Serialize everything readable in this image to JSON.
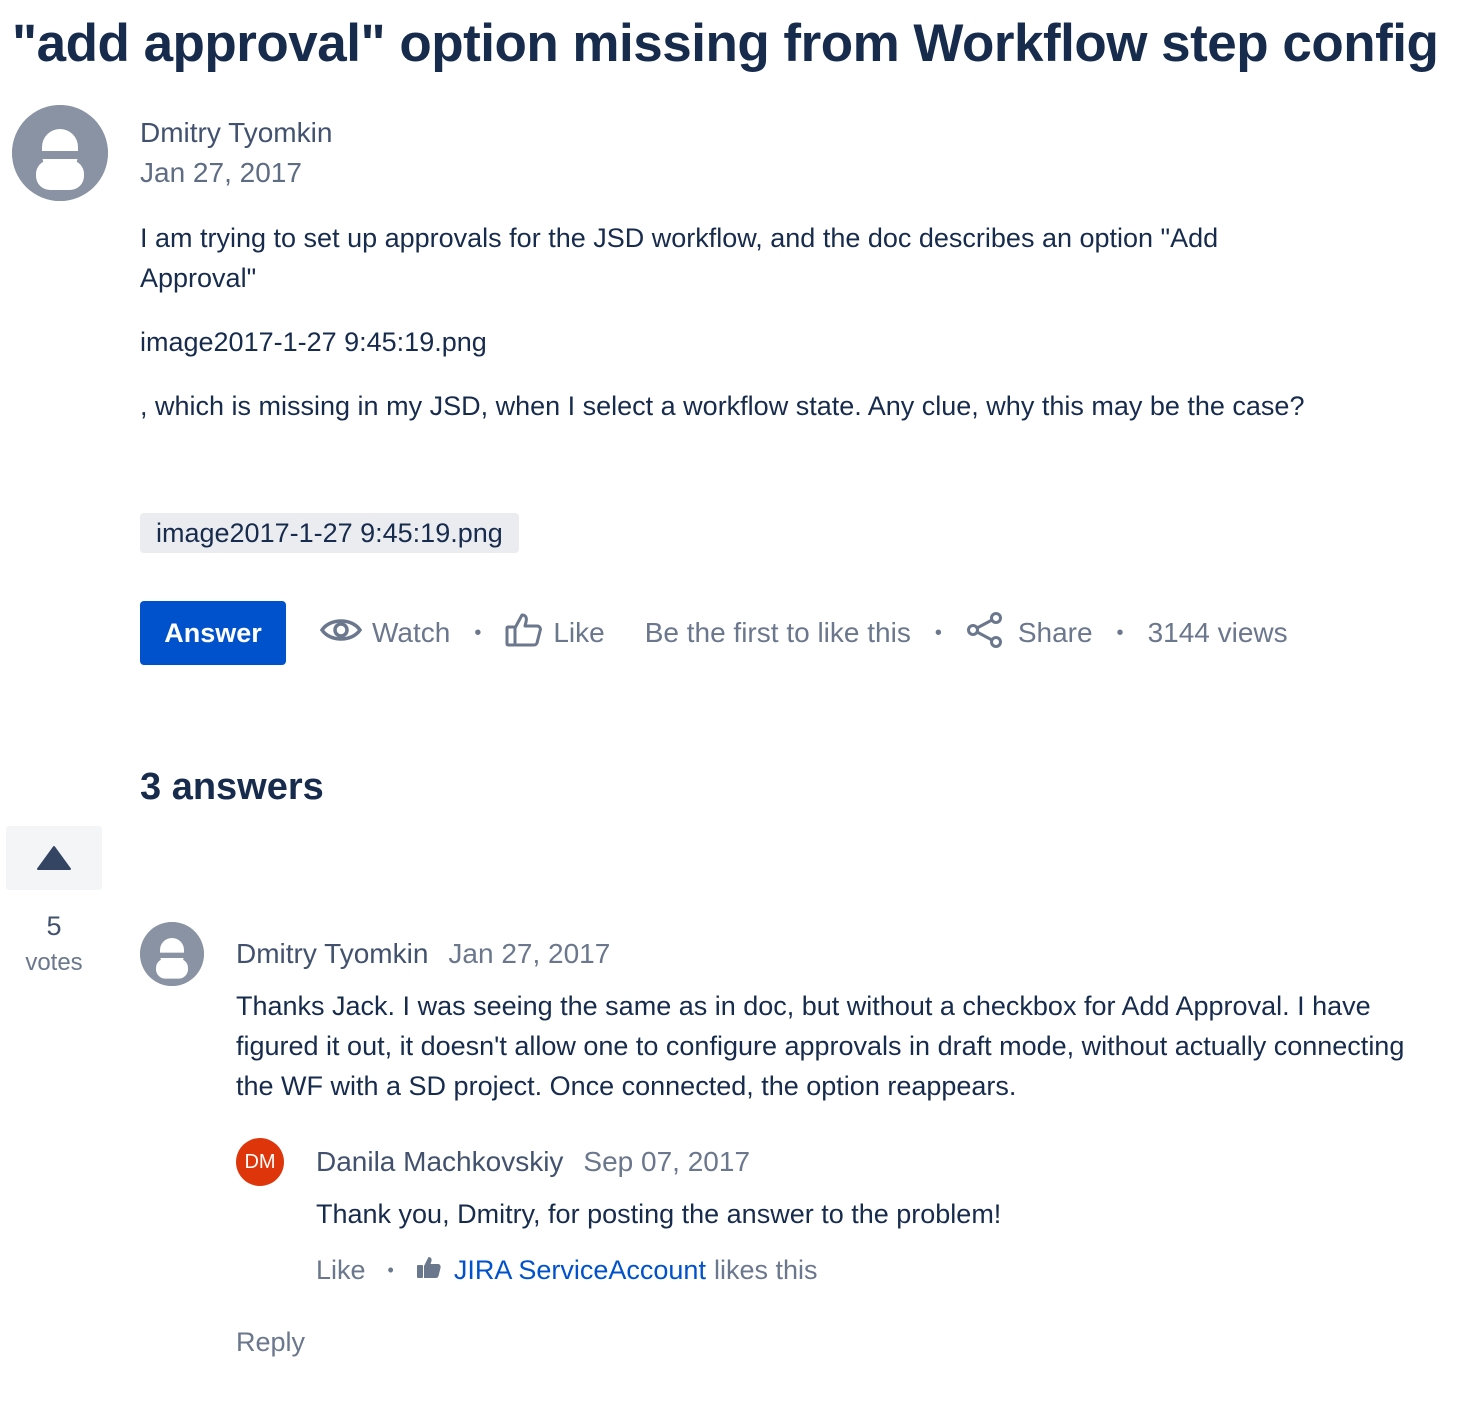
{
  "question": {
    "title": "\"add approval\" option missing from Workflow step config",
    "author": "Dmitry Tyomkin",
    "date": "Jan 27, 2017",
    "body_p1": "I am trying to set up approvals for the JSD workflow, and the doc describes an option \"Add Approval\"",
    "body_p2": "image2017-1-27 9:45:19.png",
    "body_p3": ", which is missing in my JSD, when I select a workflow state. Any clue, why this may be the case?",
    "attachment": "image2017-1-27 9:45:19.png"
  },
  "actions": {
    "answer_label": "Answer",
    "watch_label": "Watch",
    "like_label": "Like",
    "like_status": "Be the first to like this",
    "share_label": "Share",
    "views": "3144 views"
  },
  "answers_heading": "3 answers",
  "answer": {
    "votes": "5",
    "votes_label": "votes",
    "author": "Dmitry Tyomkin",
    "date": "Jan 27, 2017",
    "body": "Thanks Jack. I was seeing the same as in doc, but without a checkbox for Add Approval. I have figured it out, it doesn't allow one to configure approvals in draft mode, without actually connecting the WF with a SD project. Once connected, the option reappears."
  },
  "comment": {
    "avatar_initials": "DM",
    "author": "Danila Machkovskiy",
    "date": "Sep 07, 2017",
    "body": "Thank you, Dmitry, for posting the answer to the problem!",
    "like_label": "Like",
    "liker": "JIRA ServiceAccount",
    "likes_suffix": "likes this"
  },
  "reply_label": "Reply",
  "colors": {
    "primary": "#0052cc",
    "avatar_generic": "#8993a4",
    "avatar_dm": "#de350b",
    "text": "#172b4d",
    "muted": "#6b778c"
  }
}
